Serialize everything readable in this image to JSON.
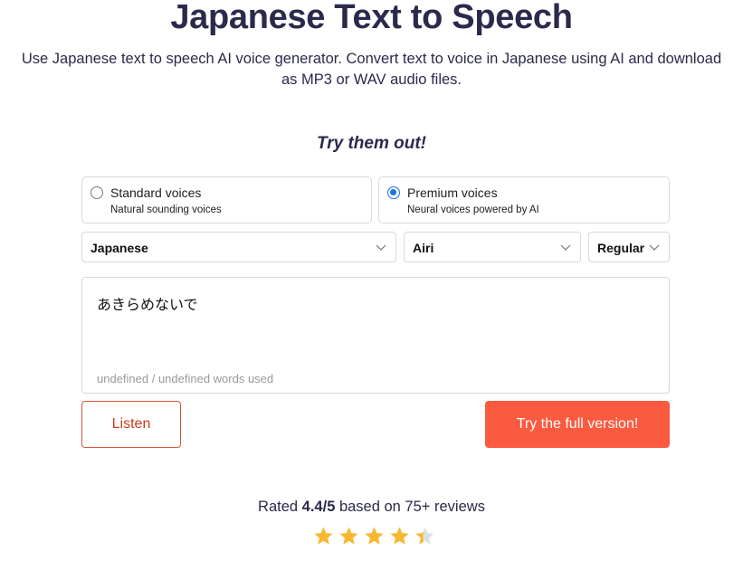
{
  "header": {
    "title": "Japanese Text to Speech",
    "subtitle": "Use Japanese text to speech AI voice generator. Convert text to voice in Japanese using AI and download as MP3 or WAV audio files."
  },
  "try_label": "Try them out!",
  "voice_types": [
    {
      "title": "Standard voices",
      "subtitle": "Natural sounding voices",
      "selected": false
    },
    {
      "title": "Premium voices",
      "subtitle": "Neural voices powered by AI",
      "selected": true
    }
  ],
  "selects": {
    "language": "Japanese",
    "voice": "Airi",
    "style": "Regular"
  },
  "editor": {
    "text": "あきらめないで",
    "word_count": "undefined / undefined words used"
  },
  "buttons": {
    "listen": "Listen",
    "full_version": "Try the full version!"
  },
  "rating": {
    "prefix": "Rated ",
    "score": "4.4/5",
    "suffix": " based on 75+ reviews",
    "value": 4.4,
    "max": 5
  },
  "colors": {
    "accent": "#fa5a3f",
    "radio": "#1a73e8",
    "star": "#f7b731",
    "star_empty": "#e0e0e0"
  }
}
